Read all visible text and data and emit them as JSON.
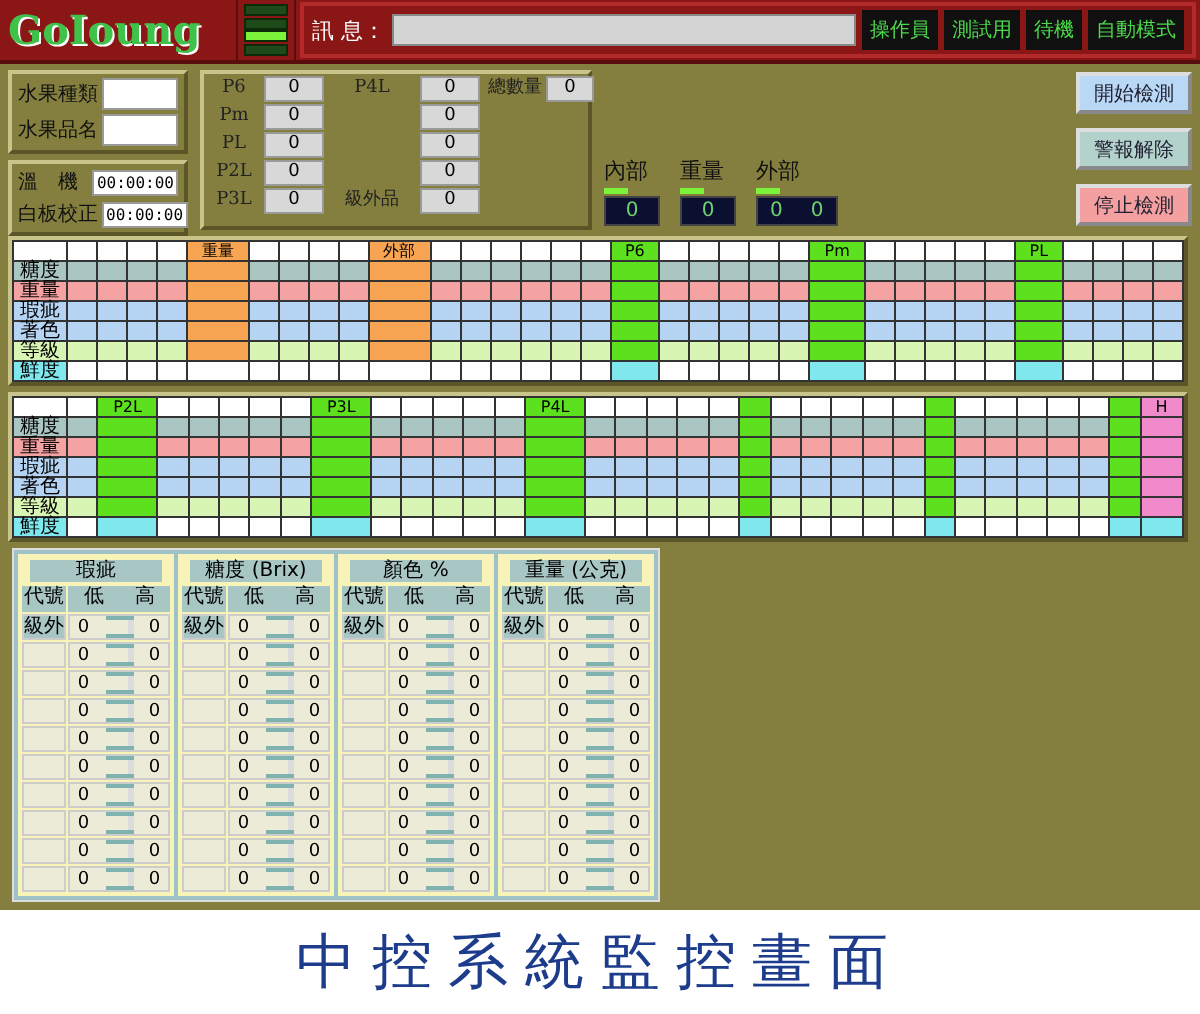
{
  "header": {
    "logo": "GoIoung",
    "leds": [
      {
        "on": false
      },
      {
        "on": false
      },
      {
        "on": true
      },
      {
        "on": false
      }
    ],
    "message_label": "訊 息：",
    "status": [
      "操作員",
      "測試用",
      "待機",
      "自動模式"
    ]
  },
  "fruit": {
    "fields": [
      {
        "label": "水果種類"
      },
      {
        "label": "水果品名"
      }
    ],
    "timers": [
      {
        "label": "溫　機",
        "value": "00:00:00"
      },
      {
        "label": "白板校正",
        "value": "00:00:00"
      }
    ]
  },
  "counts": {
    "left": [
      {
        "label": "P6",
        "value": "0"
      },
      {
        "label": "Pm",
        "value": "0"
      },
      {
        "label": "PL",
        "value": "0"
      },
      {
        "label": "P2L",
        "value": "0"
      },
      {
        "label": "P3L",
        "value": "0"
      }
    ],
    "right": [
      {
        "label": "P4L",
        "value": "0"
      },
      {
        "value": "0"
      },
      {
        "value": "0"
      },
      {
        "value": "0"
      },
      {
        "label": "級外品",
        "value": "0"
      }
    ],
    "total": {
      "label": "總數量",
      "value": "0"
    }
  },
  "gauges": [
    {
      "label": "內部",
      "readings": [
        "0"
      ]
    },
    {
      "label": "重量",
      "readings": [
        "0"
      ]
    },
    {
      "label": "外部",
      "readings": [
        "0",
        "0"
      ]
    }
  ],
  "buttons": [
    {
      "label": "開始檢測",
      "kind": "start"
    },
    {
      "label": "警報解除",
      "kind": "reset"
    },
    {
      "label": "停止檢測",
      "kind": "stop"
    }
  ],
  "grids": [
    {
      "rows": [
        {
          "label": "糖度",
          "color": "#a9c6c3"
        },
        {
          "label": "重量",
          "color": "#f4a2a2"
        },
        {
          "label": "瑕疵",
          "color": "#b5d3f2"
        },
        {
          "label": "著色",
          "color": "#b5d3f2"
        },
        {
          "label": "等級",
          "color": "#d8f5b4"
        },
        {
          "label": "鮮度",
          "color": "#ffffff"
        }
      ],
      "columns": [
        {
          "kind": "plain"
        },
        {
          "kind": "plain"
        },
        {
          "kind": "plain"
        },
        {
          "kind": "plain"
        },
        {
          "kind": "orange",
          "label": "重量"
        },
        {
          "kind": "plain"
        },
        {
          "kind": "plain"
        },
        {
          "kind": "plain"
        },
        {
          "kind": "plain"
        },
        {
          "kind": "orange",
          "label": "外部"
        },
        {
          "kind": "plain"
        },
        {
          "kind": "plain"
        },
        {
          "kind": "plain"
        },
        {
          "kind": "plain"
        },
        {
          "kind": "plain"
        },
        {
          "kind": "plain"
        },
        {
          "kind": "green",
          "label": "P6"
        },
        {
          "kind": "plain"
        },
        {
          "kind": "plain"
        },
        {
          "kind": "plain"
        },
        {
          "kind": "plain"
        },
        {
          "kind": "plain"
        },
        {
          "kind": "green",
          "label": "Pm"
        },
        {
          "kind": "plain"
        },
        {
          "kind": "plain"
        },
        {
          "kind": "plain"
        },
        {
          "kind": "plain"
        },
        {
          "kind": "plain"
        },
        {
          "kind": "green",
          "label": "PL"
        },
        {
          "kind": "plain"
        },
        {
          "kind": "plain"
        },
        {
          "kind": "plain"
        },
        {
          "kind": "plain"
        }
      ]
    },
    {
      "rows": [
        {
          "label": "糖度",
          "color": "#a9c6c3"
        },
        {
          "label": "重量",
          "color": "#f4a2a2"
        },
        {
          "label": "瑕疵",
          "color": "#b5d3f2"
        },
        {
          "label": "著色",
          "color": "#b5d3f2"
        },
        {
          "label": "等級",
          "color": "#d8f5b4"
        },
        {
          "label": "鮮度",
          "color": "#ffffff"
        }
      ],
      "columns": [
        {
          "kind": "plain"
        },
        {
          "kind": "green",
          "label": "P2L"
        },
        {
          "kind": "plain"
        },
        {
          "kind": "plain"
        },
        {
          "kind": "plain"
        },
        {
          "kind": "plain"
        },
        {
          "kind": "plain"
        },
        {
          "kind": "green",
          "label": "P3L"
        },
        {
          "kind": "plain"
        },
        {
          "kind": "plain"
        },
        {
          "kind": "plain"
        },
        {
          "kind": "plain"
        },
        {
          "kind": "plain"
        },
        {
          "kind": "green",
          "label": "P4L"
        },
        {
          "kind": "plain"
        },
        {
          "kind": "plain"
        },
        {
          "kind": "plain"
        },
        {
          "kind": "plain"
        },
        {
          "kind": "plain"
        },
        {
          "kind": "green"
        },
        {
          "kind": "plain"
        },
        {
          "kind": "plain"
        },
        {
          "kind": "plain"
        },
        {
          "kind": "plain"
        },
        {
          "kind": "plain"
        },
        {
          "kind": "green"
        },
        {
          "kind": "plain"
        },
        {
          "kind": "plain"
        },
        {
          "kind": "plain"
        },
        {
          "kind": "plain"
        },
        {
          "kind": "plain"
        },
        {
          "kind": "green"
        },
        {
          "kind": "pink",
          "label": "H"
        }
      ]
    }
  ],
  "panels": [
    {
      "title": "瑕疵",
      "headers": [
        "代號",
        "低",
        "高"
      ],
      "rows": [
        {
          "code": "級外",
          "low": "0",
          "high": "0"
        },
        {
          "low": "0",
          "high": "0"
        },
        {
          "low": "0",
          "high": "0"
        },
        {
          "low": "0",
          "high": "0"
        },
        {
          "low": "0",
          "high": "0"
        },
        {
          "low": "0",
          "high": "0"
        },
        {
          "low": "0",
          "high": "0"
        },
        {
          "low": "0",
          "high": "0"
        },
        {
          "low": "0",
          "high": "0"
        },
        {
          "low": "0",
          "high": "0"
        }
      ]
    },
    {
      "title": "糖度 (Brix)",
      "headers": [
        "代號",
        "低",
        "高"
      ],
      "rows": [
        {
          "code": "級外",
          "low": "0",
          "high": "0"
        },
        {
          "low": "0",
          "high": "0"
        },
        {
          "low": "0",
          "high": "0"
        },
        {
          "low": "0",
          "high": "0"
        },
        {
          "low": "0",
          "high": "0"
        },
        {
          "low": "0",
          "high": "0"
        },
        {
          "low": "0",
          "high": "0"
        },
        {
          "low": "0",
          "high": "0"
        },
        {
          "low": "0",
          "high": "0"
        },
        {
          "low": "0",
          "high": "0"
        }
      ]
    },
    {
      "title": "顏色 %",
      "headers": [
        "代號",
        "低",
        "高"
      ],
      "rows": [
        {
          "code": "級外",
          "low": "0",
          "high": "0"
        },
        {
          "low": "0",
          "high": "0"
        },
        {
          "low": "0",
          "high": "0"
        },
        {
          "low": "0",
          "high": "0"
        },
        {
          "low": "0",
          "high": "0"
        },
        {
          "low": "0",
          "high": "0"
        },
        {
          "low": "0",
          "high": "0"
        },
        {
          "low": "0",
          "high": "0"
        },
        {
          "low": "0",
          "high": "0"
        },
        {
          "low": "0",
          "high": "0"
        }
      ]
    },
    {
      "title": "重量 (公克)",
      "headers": [
        "代號",
        "低",
        "高"
      ],
      "rows": [
        {
          "code": "級外",
          "low": "0",
          "high": "0"
        },
        {
          "low": "0",
          "high": "0"
        },
        {
          "low": "0",
          "high": "0"
        },
        {
          "low": "0",
          "high": "0"
        },
        {
          "low": "0",
          "high": "0"
        },
        {
          "low": "0",
          "high": "0"
        },
        {
          "low": "0",
          "high": "0"
        },
        {
          "low": "0",
          "high": "0"
        },
        {
          "low": "0",
          "high": "0"
        },
        {
          "low": "0",
          "high": "0"
        }
      ]
    }
  ],
  "caption": "中控系統監控畫面"
}
